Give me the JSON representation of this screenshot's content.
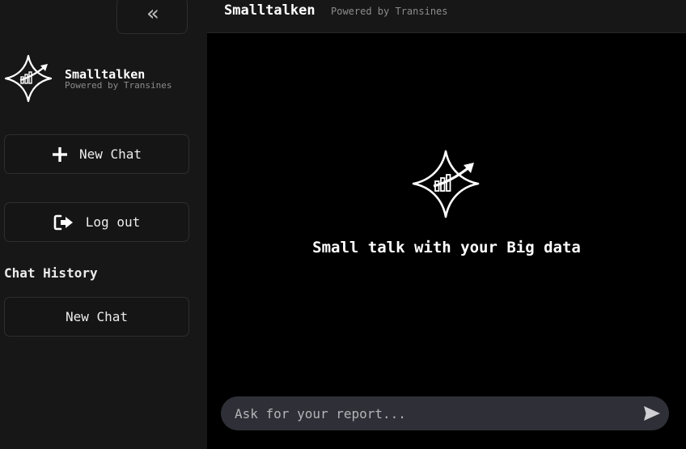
{
  "sidebar": {
    "collapse_glyph": "«",
    "brand": {
      "name": "Smalltalken",
      "subtitle": "Powered by Transines",
      "logo_icon": "sparkle-chart-logo-icon"
    },
    "new_chat_label": "New Chat",
    "new_chat_icon": "plus-icon",
    "logout_label": "Log out",
    "logout_icon": "logout-icon",
    "history_title": "Chat History",
    "history_items": [
      {
        "label": "New Chat"
      }
    ]
  },
  "header": {
    "title": "Smalltalken",
    "subtitle": "Powered by Transines"
  },
  "main": {
    "tagline": "Small talk with your Big data",
    "hero_icon": "sparkle-chart-logo-icon"
  },
  "composer": {
    "placeholder": "Ask for your report...",
    "value": "",
    "send_icon": "send-icon"
  },
  "colors": {
    "sidebar_bg": "#171717",
    "main_bg": "#000000",
    "composer_bg": "#2f3037",
    "border": "#2e2e2e",
    "text": "#ffffff",
    "muted": "#8c8c8c"
  }
}
